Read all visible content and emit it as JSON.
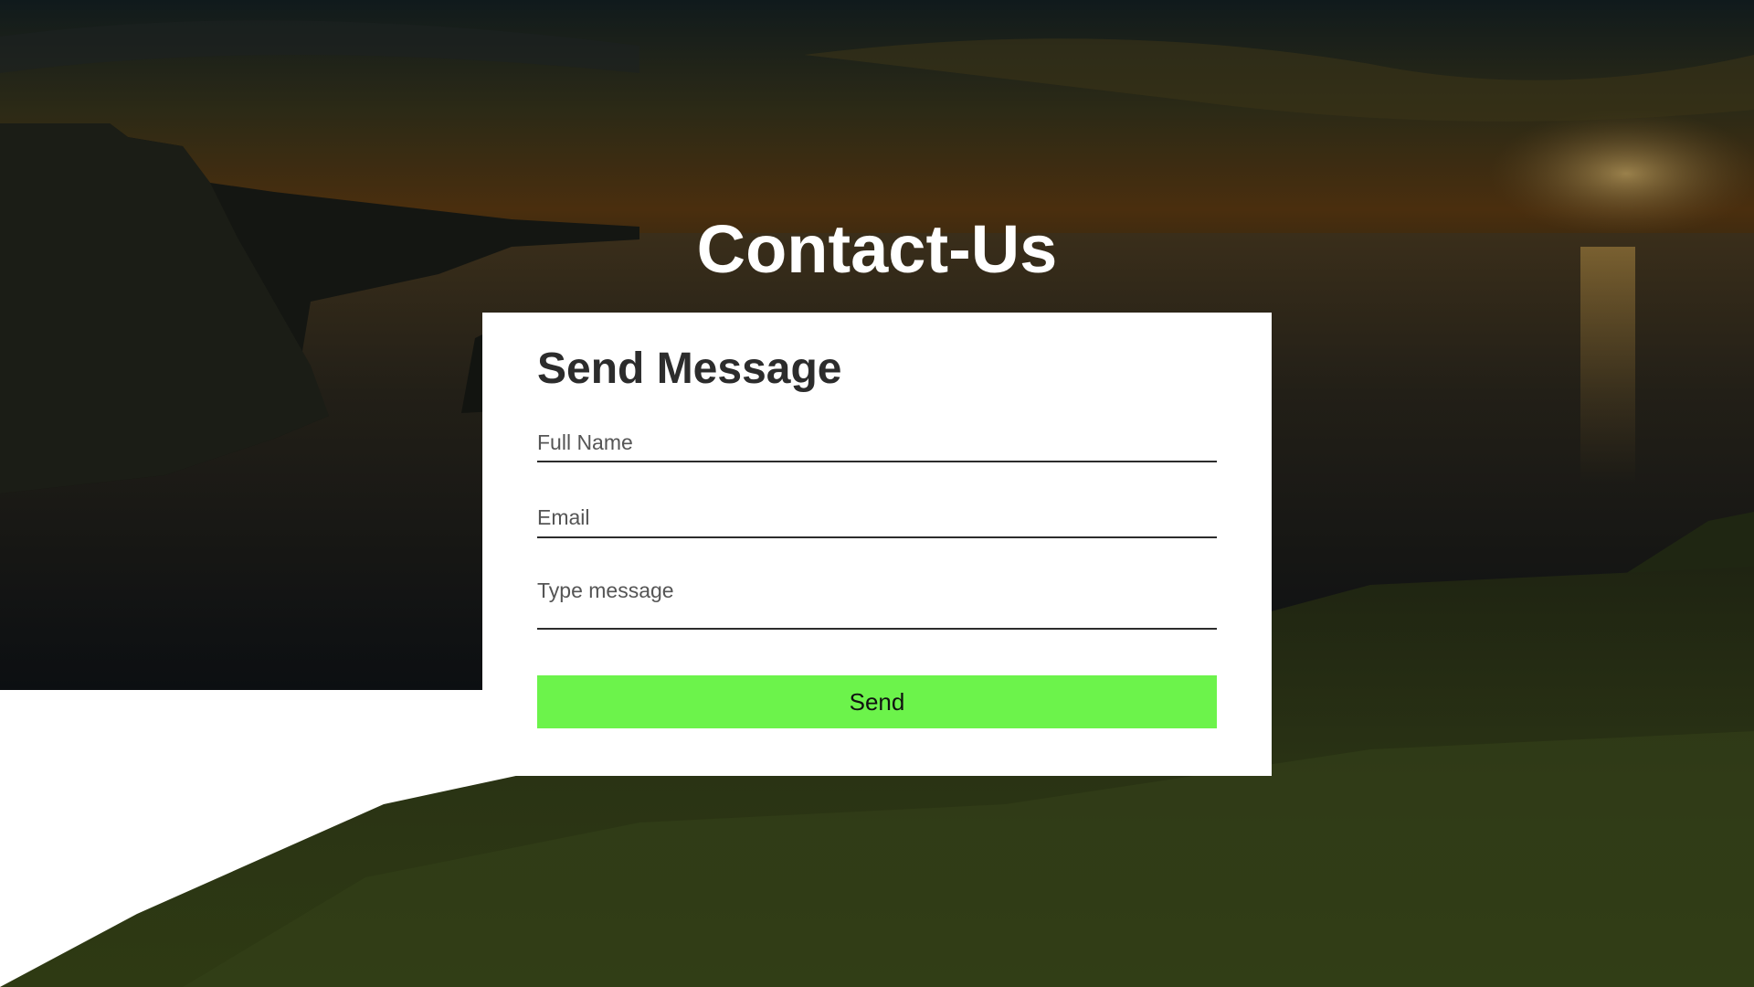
{
  "page": {
    "title": "Contact-Us"
  },
  "form": {
    "heading": "Send Message",
    "full_name_placeholder": "Full Name",
    "email_placeholder": "Email",
    "message_placeholder": "Type message",
    "send_label": "Send"
  },
  "colors": {
    "card_background": "#ffffff",
    "button_background": "#6cf34b",
    "title_text": "#ffffff",
    "heading_text": "#2c2c2c",
    "field_underline": "#2c2c2c"
  },
  "background": {
    "image": "dimmed sunset over sea cliffs and grassy headland"
  }
}
